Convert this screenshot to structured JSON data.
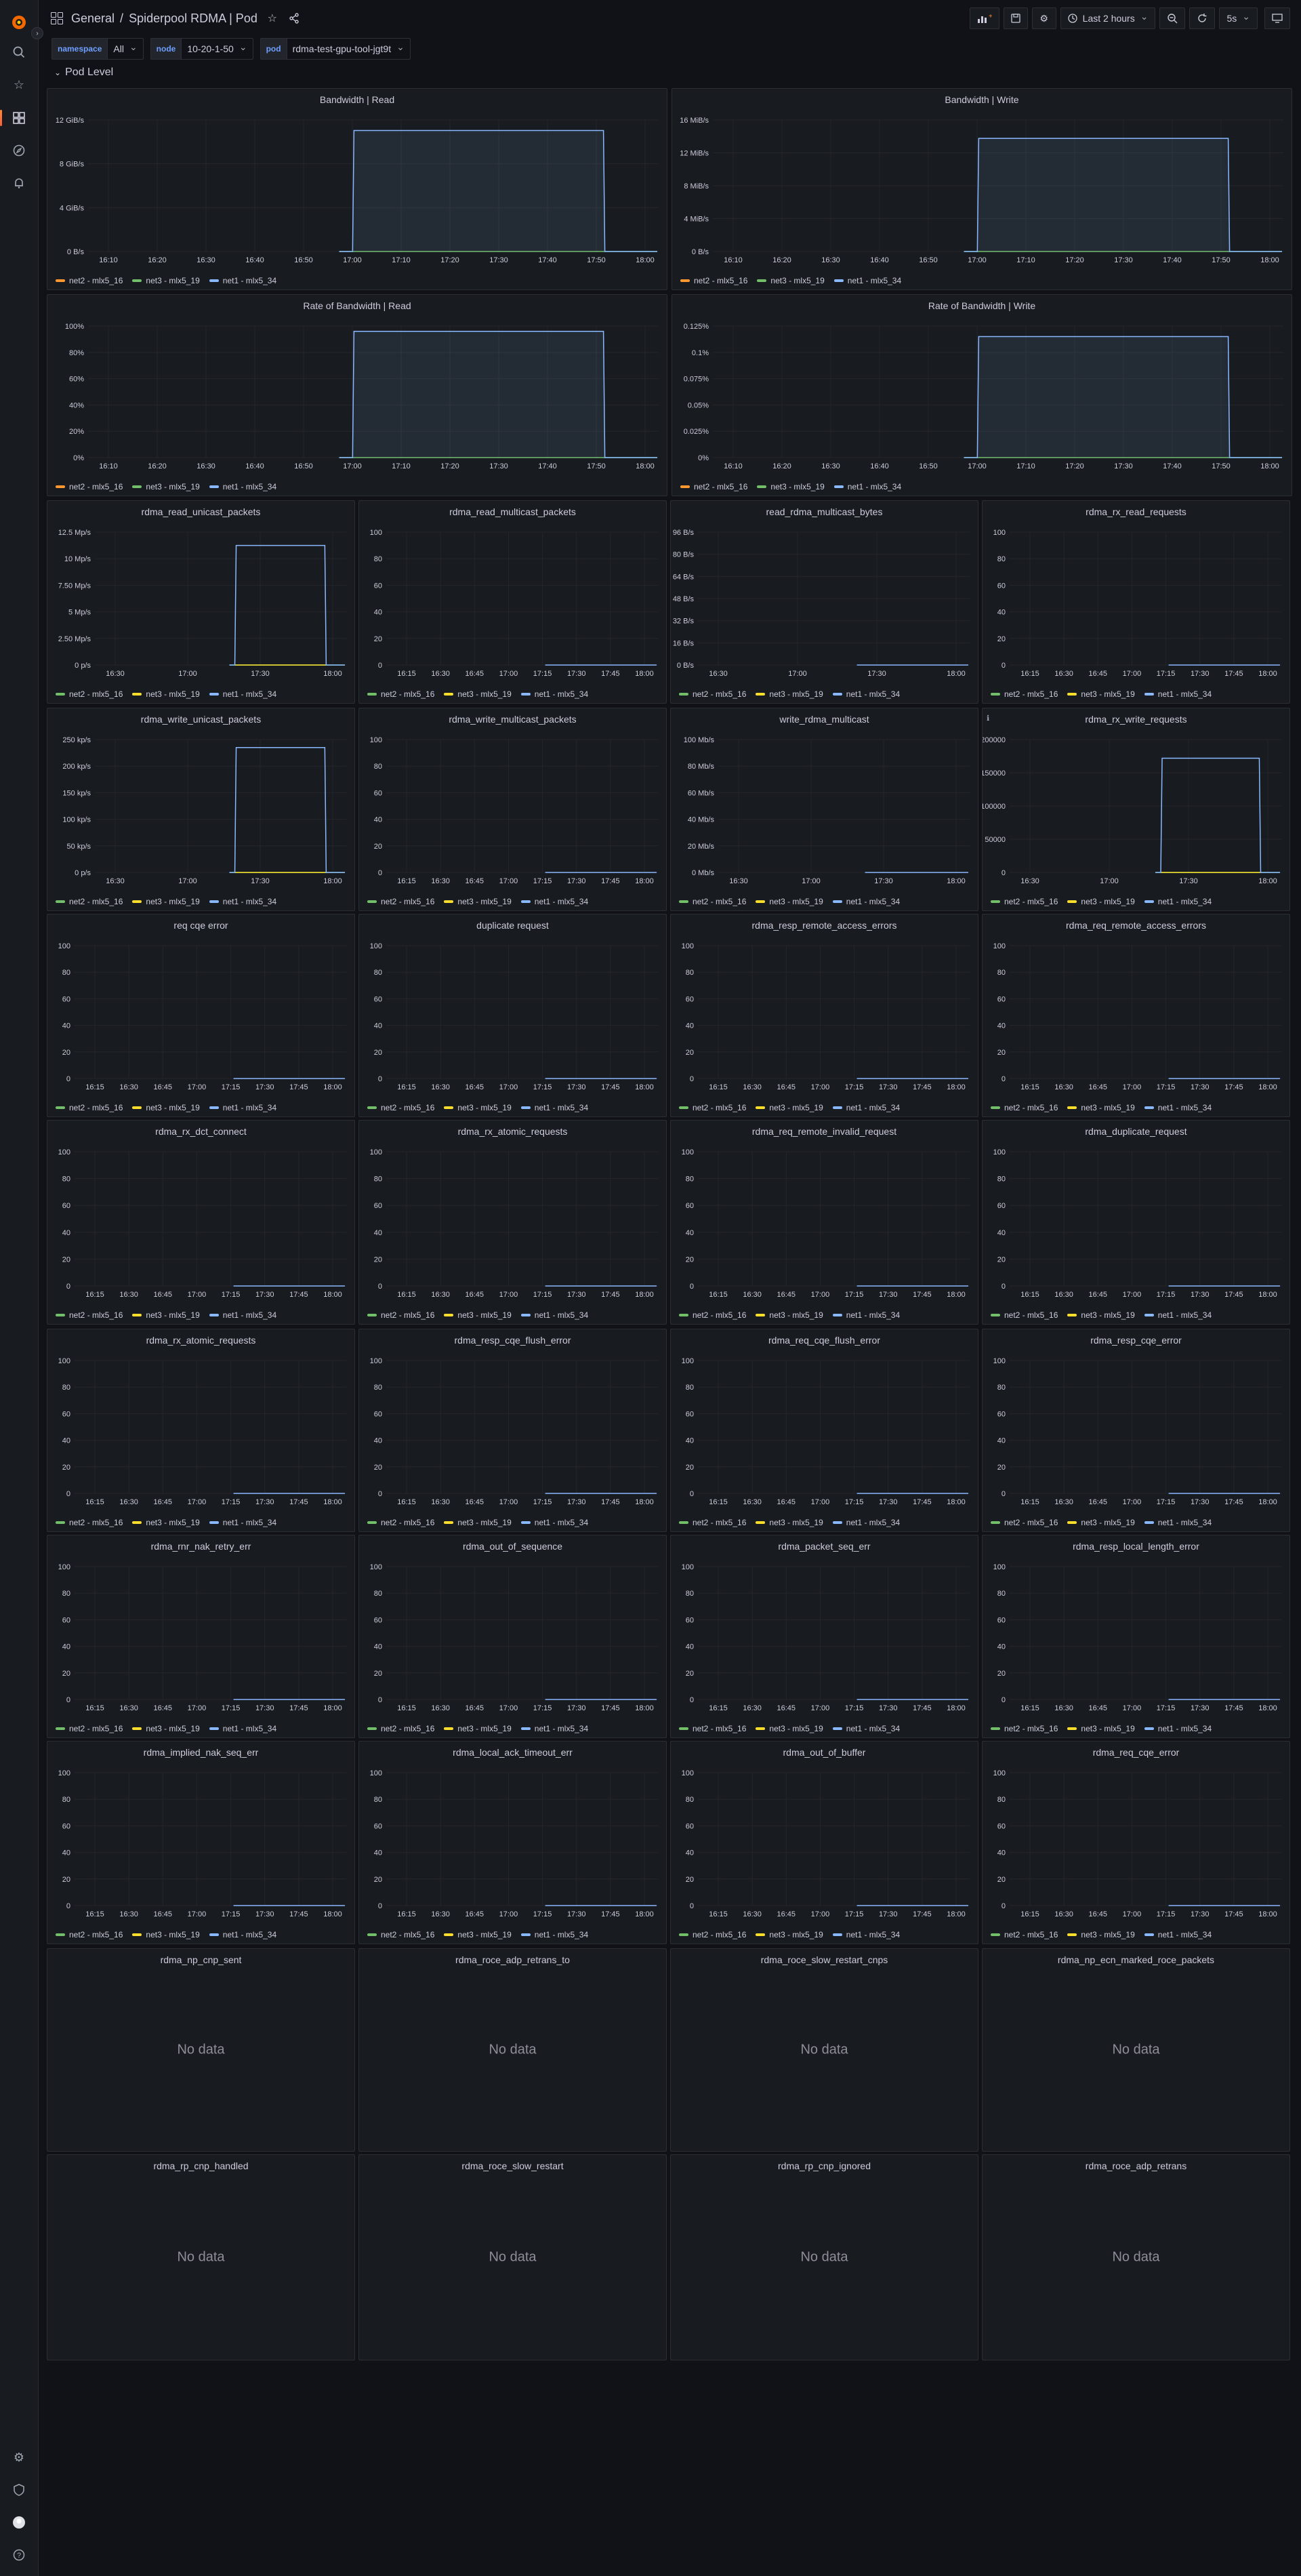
{
  "breadcrumb": {
    "section": "General",
    "title": "Spiderpool RDMA | Pod"
  },
  "toolbar": {
    "time_range": "Last 2 hours",
    "refresh_interval": "5s"
  },
  "variables": [
    {
      "name": "namespace",
      "value": "All"
    },
    {
      "name": "node",
      "value": "10-20-1-50"
    },
    {
      "name": "pod",
      "value": "rdma-test-gpu-tool-jgt9t"
    }
  ],
  "row": {
    "title": "Pod Level"
  },
  "colors": {
    "net2": "#73bf69",
    "net3": "#fade2a",
    "net1": "#8ab8ff",
    "net2_top": "#ff9830"
  },
  "legend_labels": [
    "net2 - mlx5_16",
    "net3 - mlx5_19",
    "net1 - mlx5_34"
  ],
  "no_data_text": "No data",
  "panels": [
    {
      "title": "Bandwidth | Read",
      "yticks": [
        "12 GiB/s",
        "8 GiB/s",
        "4 GiB/s",
        "0 B/s"
      ],
      "xticks": [
        "16:10",
        "16:20",
        "16:30",
        "16:40",
        "16:50",
        "17:00",
        "17:10",
        "17:20",
        "17:30",
        "17:40",
        "17:50",
        "18:00"
      ],
      "legend_first_orange": true
    },
    {
      "title": "Bandwidth | Write",
      "yticks": [
        "16 MiB/s",
        "12 MiB/s",
        "8 MiB/s",
        "4 MiB/s",
        "0 B/s"
      ],
      "xticks": [
        "16:10",
        "16:20",
        "16:30",
        "16:40",
        "16:50",
        "17:00",
        "17:10",
        "17:20",
        "17:30",
        "17:40",
        "17:50",
        "18:00"
      ],
      "legend_first_orange": true
    },
    {
      "title": "Rate of Bandwidth | Read",
      "yticks": [
        "100%",
        "80%",
        "60%",
        "40%",
        "20%",
        "0%"
      ],
      "xticks": [
        "16:10",
        "16:20",
        "16:30",
        "16:40",
        "16:50",
        "17:00",
        "17:10",
        "17:20",
        "17:30",
        "17:40",
        "17:50",
        "18:00"
      ],
      "legend_first_orange": true
    },
    {
      "title": "Rate of Bandwidth | Write",
      "yticks": [
        "0.125%",
        "0.1%",
        "0.075%",
        "0.05%",
        "0.025%",
        "0%"
      ],
      "xticks": [
        "16:10",
        "16:20",
        "16:30",
        "16:40",
        "16:50",
        "17:00",
        "17:10",
        "17:20",
        "17:30",
        "17:40",
        "17:50",
        "18:00"
      ],
      "legend_first_orange": true
    },
    {
      "title": "rdma_read_unicast_packets",
      "yticks": [
        "12.5 Mp/s",
        "10 Mp/s",
        "7.50 Mp/s",
        "5 Mp/s",
        "2.50 Mp/s",
        "0 p/s"
      ],
      "xticks": [
        "16:30",
        "17:00",
        "17:30",
        "18:00"
      ]
    },
    {
      "title": "rdma_read_multicast_packets",
      "yticks": [
        "100",
        "80",
        "60",
        "40",
        "20",
        "0"
      ],
      "xticks": [
        "16:15",
        "16:30",
        "16:45",
        "17:00",
        "17:15",
        "17:30",
        "17:45",
        "18:00"
      ]
    },
    {
      "title": "read_rdma_multicast_bytes",
      "yticks": [
        "96 B/s",
        "80 B/s",
        "64 B/s",
        "48 B/s",
        "32 B/s",
        "16 B/s",
        "0 B/s"
      ],
      "xticks": [
        "16:30",
        "17:00",
        "17:30",
        "18:00"
      ]
    },
    {
      "title": "rdma_rx_read_requests",
      "yticks": [
        "100",
        "80",
        "60",
        "40",
        "20",
        "0"
      ],
      "xticks": [
        "16:15",
        "16:30",
        "16:45",
        "17:00",
        "17:15",
        "17:30",
        "17:45",
        "18:00"
      ]
    },
    {
      "title": "rdma_write_unicast_packets",
      "yticks": [
        "250 kp/s",
        "200 kp/s",
        "150 kp/s",
        "100 kp/s",
        "50 kp/s",
        "0 p/s"
      ],
      "xticks": [
        "16:30",
        "17:00",
        "17:30",
        "18:00"
      ]
    },
    {
      "title": "rdma_write_multicast_packets",
      "yticks": [
        "100",
        "80",
        "60",
        "40",
        "20",
        "0"
      ],
      "xticks": [
        "16:15",
        "16:30",
        "16:45",
        "17:00",
        "17:15",
        "17:30",
        "17:45",
        "18:00"
      ]
    },
    {
      "title": "write_rdma_multicast",
      "yticks": [
        "100 Mb/s",
        "80 Mb/s",
        "60 Mb/s",
        "40 Mb/s",
        "20 Mb/s",
        "0 Mb/s"
      ],
      "xticks": [
        "16:30",
        "17:00",
        "17:30",
        "18:00"
      ]
    },
    {
      "title": "rdma_rx_write_requests",
      "yticks": [
        "200000",
        "150000",
        "100000",
        "50000",
        "0"
      ],
      "xticks": [
        "16:30",
        "17:00",
        "17:30",
        "18:00"
      ],
      "info": true
    },
    {
      "title": "req cqe error",
      "yticks": [
        "100",
        "80",
        "60",
        "40",
        "20",
        "0"
      ],
      "xticks": [
        "16:15",
        "16:30",
        "16:45",
        "17:00",
        "17:15",
        "17:30",
        "17:45",
        "18:00"
      ]
    },
    {
      "title": "duplicate request",
      "yticks": [
        "100",
        "80",
        "60",
        "40",
        "20",
        "0"
      ],
      "xticks": [
        "16:15",
        "16:30",
        "16:45",
        "17:00",
        "17:15",
        "17:30",
        "17:45",
        "18:00"
      ]
    },
    {
      "title": "rdma_resp_remote_access_errors",
      "yticks": [
        "100",
        "80",
        "60",
        "40",
        "20",
        "0"
      ],
      "xticks": [
        "16:15",
        "16:30",
        "16:45",
        "17:00",
        "17:15",
        "17:30",
        "17:45",
        "18:00"
      ]
    },
    {
      "title": "rdma_req_remote_access_errors",
      "yticks": [
        "100",
        "80",
        "60",
        "40",
        "20",
        "0"
      ],
      "xticks": [
        "16:15",
        "16:30",
        "16:45",
        "17:00",
        "17:15",
        "17:30",
        "17:45",
        "18:00"
      ]
    },
    {
      "title": "rdma_rx_dct_connect",
      "yticks": [
        "100",
        "80",
        "60",
        "40",
        "20",
        "0"
      ],
      "xticks": [
        "16:15",
        "16:30",
        "16:45",
        "17:00",
        "17:15",
        "17:30",
        "17:45",
        "18:00"
      ]
    },
    {
      "title": "rdma_rx_atomic_requests",
      "yticks": [
        "100",
        "80",
        "60",
        "40",
        "20",
        "0"
      ],
      "xticks": [
        "16:15",
        "16:30",
        "16:45",
        "17:00",
        "17:15",
        "17:30",
        "17:45",
        "18:00"
      ]
    },
    {
      "title": "rdma_req_remote_invalid_request",
      "yticks": [
        "100",
        "80",
        "60",
        "40",
        "20",
        "0"
      ],
      "xticks": [
        "16:15",
        "16:30",
        "16:45",
        "17:00",
        "17:15",
        "17:30",
        "17:45",
        "18:00"
      ]
    },
    {
      "title": "rdma_duplicate_request",
      "yticks": [
        "100",
        "80",
        "60",
        "40",
        "20",
        "0"
      ],
      "xticks": [
        "16:15",
        "16:30",
        "16:45",
        "17:00",
        "17:15",
        "17:30",
        "17:45",
        "18:00"
      ]
    },
    {
      "title": "rdma_rx_atomic_requests",
      "yticks": [
        "100",
        "80",
        "60",
        "40",
        "20",
        "0"
      ],
      "xticks": [
        "16:15",
        "16:30",
        "16:45",
        "17:00",
        "17:15",
        "17:30",
        "17:45",
        "18:00"
      ]
    },
    {
      "title": "rdma_resp_cqe_flush_error",
      "yticks": [
        "100",
        "80",
        "60",
        "40",
        "20",
        "0"
      ],
      "xticks": [
        "16:15",
        "16:30",
        "16:45",
        "17:00",
        "17:15",
        "17:30",
        "17:45",
        "18:00"
      ]
    },
    {
      "title": "rdma_req_cqe_flush_error",
      "yticks": [
        "100",
        "80",
        "60",
        "40",
        "20",
        "0"
      ],
      "xticks": [
        "16:15",
        "16:30",
        "16:45",
        "17:00",
        "17:15",
        "17:30",
        "17:45",
        "18:00"
      ]
    },
    {
      "title": "rdma_resp_cqe_error",
      "yticks": [
        "100",
        "80",
        "60",
        "40",
        "20",
        "0"
      ],
      "xticks": [
        "16:15",
        "16:30",
        "16:45",
        "17:00",
        "17:15",
        "17:30",
        "17:45",
        "18:00"
      ]
    },
    {
      "title": "rdma_rnr_nak_retry_err",
      "yticks": [
        "100",
        "80",
        "60",
        "40",
        "20",
        "0"
      ],
      "xticks": [
        "16:15",
        "16:30",
        "16:45",
        "17:00",
        "17:15",
        "17:30",
        "17:45",
        "18:00"
      ]
    },
    {
      "title": "rdma_out_of_sequence",
      "yticks": [
        "100",
        "80",
        "60",
        "40",
        "20",
        "0"
      ],
      "xticks": [
        "16:15",
        "16:30",
        "16:45",
        "17:00",
        "17:15",
        "17:30",
        "17:45",
        "18:00"
      ]
    },
    {
      "title": "rdma_packet_seq_err",
      "yticks": [
        "100",
        "80",
        "60",
        "40",
        "20",
        "0"
      ],
      "xticks": [
        "16:15",
        "16:30",
        "16:45",
        "17:00",
        "17:15",
        "17:30",
        "17:45",
        "18:00"
      ]
    },
    {
      "title": "rdma_resp_local_length_error",
      "yticks": [
        "100",
        "80",
        "60",
        "40",
        "20",
        "0"
      ],
      "xticks": [
        "16:15",
        "16:30",
        "16:45",
        "17:00",
        "17:15",
        "17:30",
        "17:45",
        "18:00"
      ]
    },
    {
      "title": "rdma_implied_nak_seq_err",
      "yticks": [
        "100",
        "80",
        "60",
        "40",
        "20",
        "0"
      ],
      "xticks": [
        "16:15",
        "16:30",
        "16:45",
        "17:00",
        "17:15",
        "17:30",
        "17:45",
        "18:00"
      ]
    },
    {
      "title": "rdma_local_ack_timeout_err",
      "yticks": [
        "100",
        "80",
        "60",
        "40",
        "20",
        "0"
      ],
      "xticks": [
        "16:15",
        "16:30",
        "16:45",
        "17:00",
        "17:15",
        "17:30",
        "17:45",
        "18:00"
      ]
    },
    {
      "title": "rdma_out_of_buffer",
      "yticks": [
        "100",
        "80",
        "60",
        "40",
        "20",
        "0"
      ],
      "xticks": [
        "16:15",
        "16:30",
        "16:45",
        "17:00",
        "17:15",
        "17:30",
        "17:45",
        "18:00"
      ]
    },
    {
      "title": "rdma_req_cqe_error",
      "yticks": [
        "100",
        "80",
        "60",
        "40",
        "20",
        "0"
      ],
      "xticks": [
        "16:15",
        "16:30",
        "16:45",
        "17:00",
        "17:15",
        "17:30",
        "17:45",
        "18:00"
      ]
    },
    {
      "title": "rdma_np_cnp_sent",
      "nodata": true
    },
    {
      "title": "rdma_roce_adp_retrans_to",
      "nodata": true
    },
    {
      "title": "rdma_roce_slow_restart_cnps",
      "nodata": true
    },
    {
      "title": "rdma_np_ecn_marked_roce_packets",
      "nodata": true
    },
    {
      "title": "rdma_rp_cnp_handled",
      "nodata": true
    },
    {
      "title": "rdma_roce_slow_restart",
      "nodata": true
    },
    {
      "title": "rdma_rp_cnp_ignored",
      "nodata": true
    },
    {
      "title": "rdma_roce_adp_retrans",
      "nodata": true
    }
  ],
  "chart_data": [
    {
      "type": "area",
      "title": "Bandwidth | Read",
      "x": [
        "16:10",
        "17:00",
        "17:01",
        "18:00",
        "18:01"
      ],
      "series": [
        {
          "name": "net1 - mlx5_34",
          "values": [
            "0 B/s",
            "0 B/s",
            "11.5 GiB/s",
            "11.5 GiB/s",
            "0 B/s"
          ]
        },
        {
          "name": "net2 - mlx5_16",
          "values": [
            "0 B/s"
          ]
        },
        {
          "name": "net3 - mlx5_19",
          "values": [
            "0 B/s"
          ]
        }
      ]
    },
    {
      "type": "area",
      "title": "Bandwidth | Write",
      "x": [
        "16:10",
        "17:00",
        "17:01",
        "18:00",
        "18:01"
      ],
      "series": [
        {
          "name": "net1 - mlx5_34",
          "values": [
            "0 B/s",
            "0 B/s",
            "14 MiB/s",
            "14 MiB/s",
            "0 B/s"
          ]
        }
      ]
    },
    {
      "type": "area",
      "title": "Rate of Bandwidth | Read",
      "x": [
        "16:10",
        "17:00",
        "17:01",
        "18:00",
        "18:01"
      ],
      "series": [
        {
          "name": "net1 - mlx5_34",
          "values": [
            "0%",
            "0%",
            "96%",
            "96%",
            "0%"
          ]
        }
      ]
    },
    {
      "type": "area",
      "title": "Rate of Bandwidth | Write",
      "x": [
        "16:10",
        "17:00",
        "17:01",
        "18:00",
        "18:01"
      ],
      "series": [
        {
          "name": "net1 - mlx5_34",
          "values": [
            "0%",
            "0%",
            "0.115%",
            "0.115%",
            "0%"
          ]
        }
      ]
    },
    {
      "type": "line",
      "title": "rdma_read_unicast_packets",
      "x": [
        "17:00",
        "17:01",
        "18:00",
        "18:01"
      ],
      "series": [
        {
          "name": "net1 - mlx5_34",
          "values": [
            "0 p/s",
            "11.2 Mp/s",
            "11.2 Mp/s",
            "0 p/s"
          ]
        }
      ]
    },
    {
      "type": "line",
      "title": "rdma_write_unicast_packets",
      "x": [
        "17:00",
        "17:01",
        "18:00",
        "18:01"
      ],
      "series": [
        {
          "name": "net1 - mlx5_34",
          "values": [
            "0 p/s",
            "235 kp/s",
            "235 kp/s",
            "0 p/s"
          ]
        }
      ]
    },
    {
      "type": "line",
      "title": "rdma_rx_write_requests",
      "x": [
        "17:00",
        "17:01",
        "18:00",
        "18:01"
      ],
      "series": [
        {
          "name": "net1 - mlx5_34",
          "values": [
            0,
            172000,
            172000,
            0
          ]
        }
      ]
    }
  ]
}
